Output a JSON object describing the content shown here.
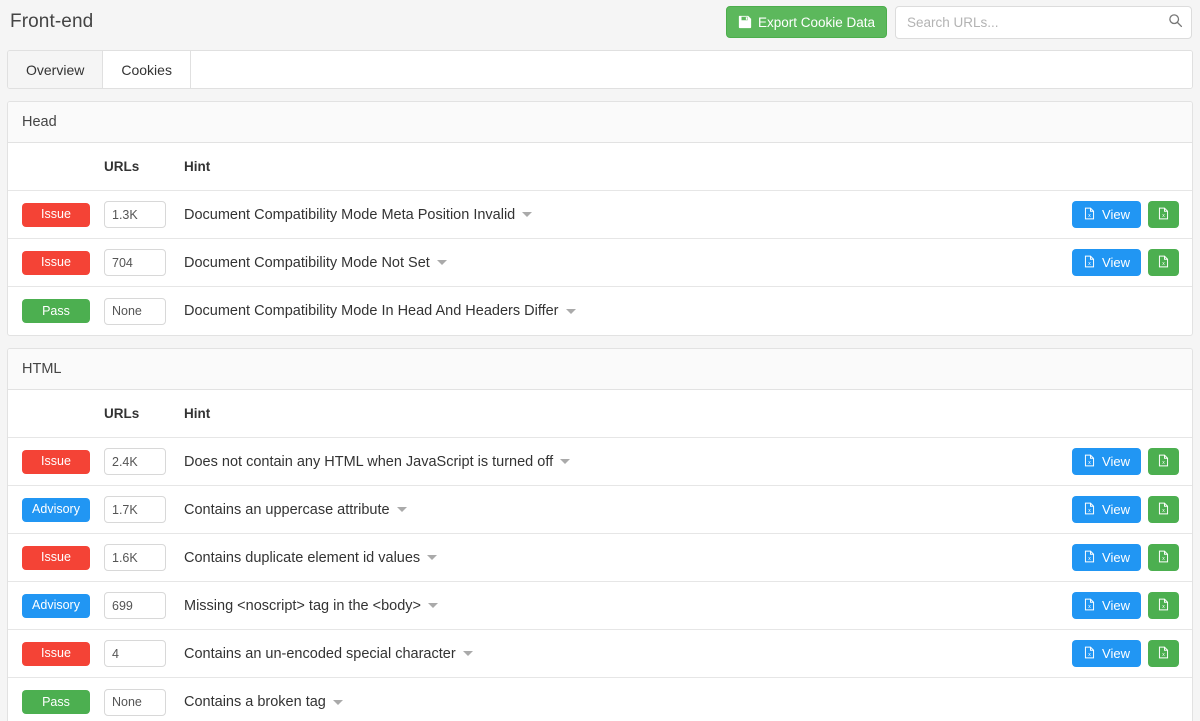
{
  "header": {
    "title": "Front-end",
    "export_label": "Export Cookie Data",
    "export_icon": "save-icon",
    "search_placeholder": "Search URLs...",
    "search_value": "",
    "search_icon": "search-icon"
  },
  "tabs": [
    {
      "label": "Overview",
      "active": true
    },
    {
      "label": "Cookies",
      "active": false
    }
  ],
  "columns": {
    "status": "",
    "urls": "URLs",
    "hint": "Hint"
  },
  "actions": {
    "view_label": "View",
    "view_icon": "file-excel-icon",
    "export_icon": "file-excel-icon"
  },
  "colors": {
    "issue": "#f44336",
    "pass": "#4caf50",
    "advisory": "#2196f3",
    "view_button": "#2196f3",
    "export_button": "#5cb85c"
  },
  "panels": [
    {
      "title": "Head",
      "rows": [
        {
          "status": "Issue",
          "status_type": "issue",
          "urls": "1.3K",
          "hint": "Document Compatibility Mode Meta Position Invalid",
          "has_actions": true
        },
        {
          "status": "Issue",
          "status_type": "issue",
          "urls": "704",
          "hint": "Document Compatibility Mode Not Set",
          "has_actions": true
        },
        {
          "status": "Pass",
          "status_type": "pass",
          "urls": "None",
          "hint": "Document Compatibility Mode In Head And Headers Differ",
          "has_actions": false
        }
      ]
    },
    {
      "title": "HTML",
      "rows": [
        {
          "status": "Issue",
          "status_type": "issue",
          "urls": "2.4K",
          "hint": "Does not contain any HTML when JavaScript is turned off",
          "has_actions": true
        },
        {
          "status": "Advisory",
          "status_type": "advisory",
          "urls": "1.7K",
          "hint": "Contains an uppercase attribute",
          "has_actions": true
        },
        {
          "status": "Issue",
          "status_type": "issue",
          "urls": "1.6K",
          "hint": "Contains duplicate element id values",
          "has_actions": true
        },
        {
          "status": "Advisory",
          "status_type": "advisory",
          "urls": "699",
          "hint": "Missing <noscript> tag in the <body>",
          "has_actions": true
        },
        {
          "status": "Issue",
          "status_type": "issue",
          "urls": "4",
          "hint": "Contains an un-encoded special character",
          "has_actions": true
        },
        {
          "status": "Pass",
          "status_type": "pass",
          "urls": "None",
          "hint": "Contains a broken tag",
          "has_actions": false
        }
      ]
    }
  ]
}
